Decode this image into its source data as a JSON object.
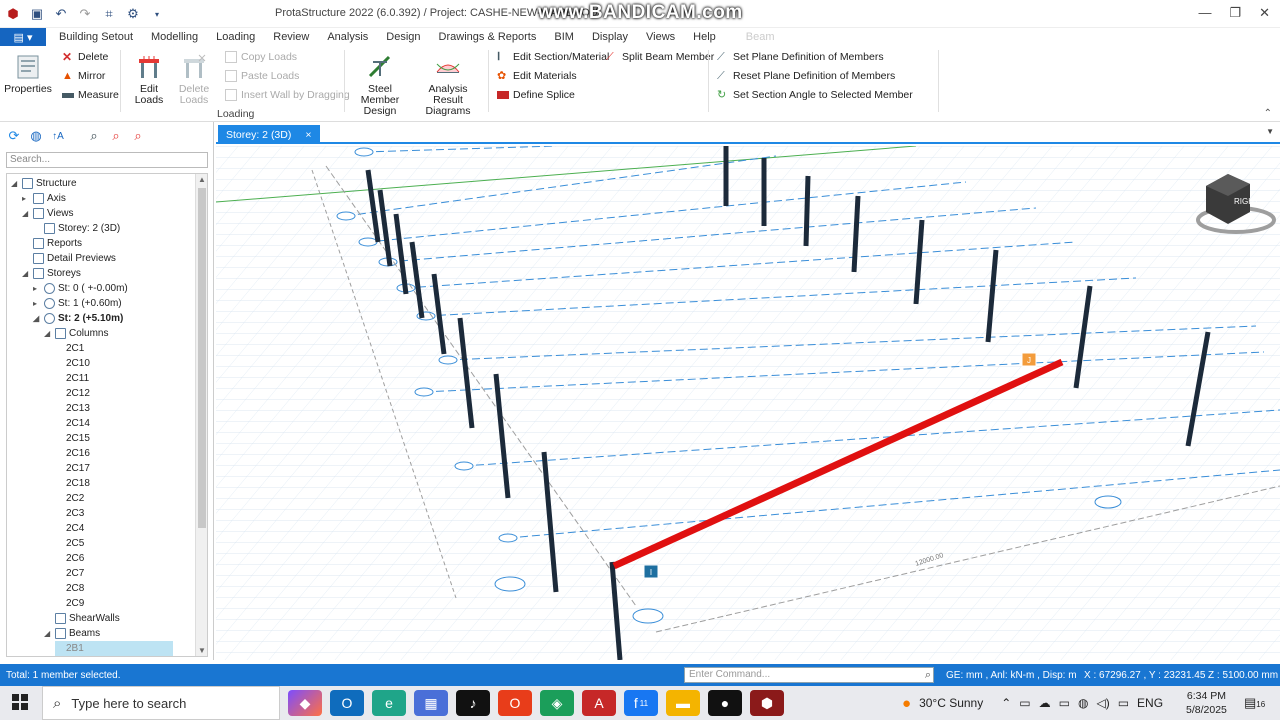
{
  "window": {
    "title": "ProtaStructure 2022 (6.0.392) / Project: CASHE-NEW-WAREHOU",
    "watermark": "www.BANDICAM.com"
  },
  "menu": {
    "file_icon": "app-menu-icon",
    "items": [
      "Building Setout",
      "Modelling",
      "Loading",
      "Review",
      "Analysis",
      "Design",
      "Drawings & Reports",
      "BIM",
      "Display",
      "Views",
      "Help"
    ],
    "context_tab": "Beam"
  },
  "ribbon": {
    "properties": "Properties",
    "delete": "Delete",
    "mirror": "Mirror",
    "measure": "Measure",
    "edit_loads": "Edit Loads",
    "delete_loads": "Delete Loads",
    "copy_loads": "Copy Loads",
    "paste_loads": "Paste Loads",
    "insert_wall": "Insert Wall by Dragging",
    "steel_member_design": "Steel Member Design",
    "analysis_result_diagrams": "Analysis Result Diagrams",
    "edit_section_material": "Edit Section/Material",
    "edit_materials": "Edit Materials",
    "define_splice": "Define Splice",
    "split_beam_member": "Split Beam Member",
    "set_plane_def": "Set Plane Definition of Members",
    "reset_plane_def": "Reset Plane Definition of Members",
    "set_section_angle": "Set Section Angle to Selected Member",
    "group_label": "Loading"
  },
  "left_panel": {
    "search_placeholder": "Search...",
    "tree": [
      {
        "label": "Structure",
        "level": 0,
        "exp": "◢"
      },
      {
        "label": "Axis",
        "level": 1,
        "exp": "▸"
      },
      {
        "label": "Views",
        "level": 1,
        "exp": "◢"
      },
      {
        "label": "Storey: 2 (3D)",
        "level": 2,
        "exp": ""
      },
      {
        "label": "Reports",
        "level": 1,
        "exp": ""
      },
      {
        "label": "Detail Previews",
        "level": 1,
        "exp": ""
      },
      {
        "label": "Storeys",
        "level": 1,
        "exp": "◢"
      },
      {
        "label": "St: 0 ( +-0.00m)",
        "level": 2,
        "exp": "▸"
      },
      {
        "label": "St: 1 (+0.60m)",
        "level": 2,
        "exp": "▸"
      },
      {
        "label": "St: 2 (+5.10m)",
        "level": 2,
        "exp": "◢",
        "bold": true
      },
      {
        "label": "Columns",
        "level": 3,
        "exp": "◢"
      },
      {
        "label": "2C1",
        "level": 4
      },
      {
        "label": "2C10",
        "level": 4
      },
      {
        "label": "2C11",
        "level": 4
      },
      {
        "label": "2C12",
        "level": 4
      },
      {
        "label": "2C13",
        "level": 4
      },
      {
        "label": "2C14",
        "level": 4
      },
      {
        "label": "2C15",
        "level": 4
      },
      {
        "label": "2C16",
        "level": 4
      },
      {
        "label": "2C17",
        "level": 4
      },
      {
        "label": "2C18",
        "level": 4
      },
      {
        "label": "2C2",
        "level": 4
      },
      {
        "label": "2C3",
        "level": 4
      },
      {
        "label": "2C4",
        "level": 4
      },
      {
        "label": "2C5",
        "level": 4
      },
      {
        "label": "2C6",
        "level": 4
      },
      {
        "label": "2C7",
        "level": 4
      },
      {
        "label": "2C8",
        "level": 4
      },
      {
        "label": "2C9",
        "level": 4
      },
      {
        "label": "ShearWalls",
        "level": 3,
        "exp": ""
      },
      {
        "label": "Beams",
        "level": 3,
        "exp": "◢"
      },
      {
        "label": "2B1",
        "level": 4,
        "sel": true
      }
    ]
  },
  "viewport": {
    "tab": "Storey: 2 (3D)",
    "tab_close": "×",
    "viewcube_label": "RIGHT",
    "node_i": "I",
    "node_j": "J",
    "axis_labels": [
      "A",
      "B",
      "1",
      "2",
      "3",
      "4",
      "5",
      "6",
      "7",
      "8",
      "9"
    ],
    "dimension": "12000.00"
  },
  "status": {
    "left": "Total: 1 member selected.",
    "command_placeholder": "Enter Command...",
    "units": "GE: mm , Anl: kN-m , Disp: m",
    "coords": "X : 67296.27 , Y : 23231.45",
    "elevation": "Z : 5100.00 mm"
  },
  "taskbar": {
    "search": "Type here to search",
    "weather": "30°C  Sunny",
    "lang": "ENG",
    "time": "6:34 PM",
    "date": "5/8/2025",
    "notif_count": "16",
    "facebook_badge": "11"
  }
}
